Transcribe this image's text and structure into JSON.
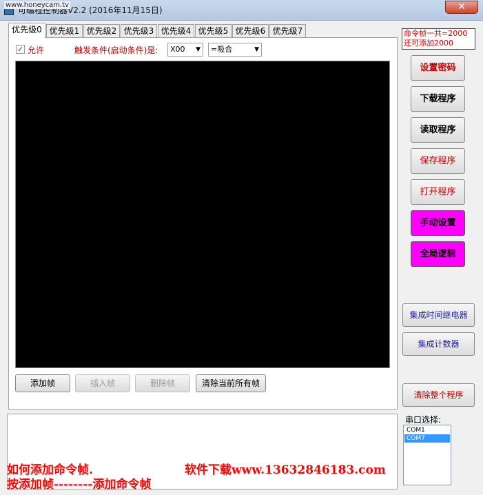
{
  "window": {
    "watermark": "www.honeycam.tv",
    "title": "可编程控制器V2.2  (2016年11月15日)",
    "close_label": "✕"
  },
  "tabs": [
    "优先级0",
    "优先级1",
    "优先级2",
    "优先级3",
    "优先级4",
    "优先级5",
    "优先级6",
    "优先级7"
  ],
  "active_tab": 0,
  "trigger": {
    "allow_checked": true,
    "allow_label": "允许",
    "condition_label": "触发条件(启动条件)是:",
    "input_value": "X00",
    "state_value": "=吸合"
  },
  "frame_buttons": {
    "add": "添加帧",
    "insert": "插入帧",
    "delete": "删除帧",
    "clear": "清除当前所有帧"
  },
  "sidebar": {
    "frame_info_line1": "命令帧一共=2000",
    "frame_info_line2": "还可添加2000",
    "set_password": "设置密码",
    "download_program": "下载程序",
    "read_program": "读取程序",
    "save_program": "保存程序",
    "open_program": "打开程序",
    "manual_settings": "手动设置",
    "global_logic": "全局逻辑",
    "integrated_timer_relay": "集成时间继电器",
    "integrated_counter": "集成计数器",
    "clear_program": "清除整个程序"
  },
  "serial": {
    "label": "串口选择:",
    "ports": [
      "COM1",
      "COM7"
    ],
    "selected": "COM7"
  },
  "overlay": {
    "line1_left": "如何添加命令帧.",
    "line1_right": "软件下载www.13632846183.com",
    "line2": "按添加帧--------添加命令帧"
  },
  "colors": {
    "accent_red": "#c00000",
    "magenta": "#ff00ff",
    "link_blue": "#1f1fa6"
  }
}
